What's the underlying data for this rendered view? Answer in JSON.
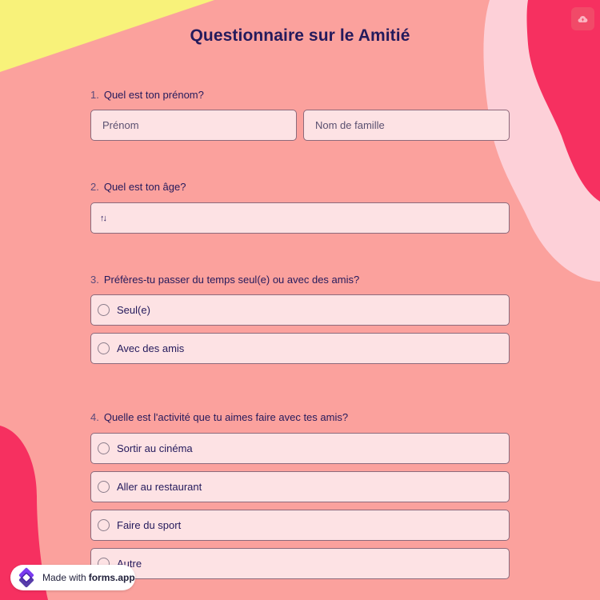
{
  "colors": {
    "background": "#fba19d",
    "yellow_shape": "#f8f27a",
    "pink_shape": "#f63060",
    "light_pink_shape": "#fdd0d8",
    "field_background": "#fde2e4",
    "title": "#241a5c"
  },
  "header": {
    "title": "Questionnaire sur le Amitié",
    "corner_icon": "cloud-upload-icon"
  },
  "questions": [
    {
      "number": "1.",
      "label": "Quel est ton prénom?",
      "first_name_placeholder": "Prénom",
      "last_name_placeholder": "Nom de famille"
    },
    {
      "number": "2.",
      "label": "Quel est ton âge?",
      "number_icon": "↑↓",
      "value": ""
    },
    {
      "number": "3.",
      "label": "Préfères-tu passer du temps seul(e) ou avec des amis?",
      "options": [
        "Seul(e)",
        "Avec des amis"
      ]
    },
    {
      "number": "4.",
      "label": "Quelle est l'activité que tu aimes faire avec tes amis?",
      "options": [
        "Sortir au cinéma",
        "Aller au restaurant",
        "Faire du sport",
        "Autre"
      ]
    }
  ],
  "footer": {
    "made_with": "Made with",
    "brand": "forms.app",
    "logo_icon": "forms-app-logo-icon"
  }
}
